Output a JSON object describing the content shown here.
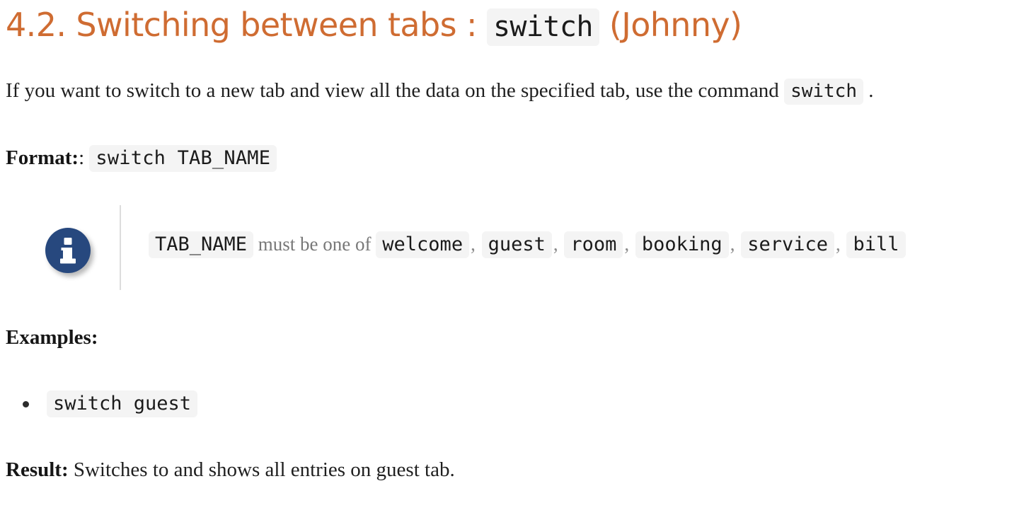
{
  "heading": {
    "number": "4.2.",
    "title": "Switching between tabs :",
    "command": "switch",
    "author": "(Johnny)",
    "color": "#cf6c32"
  },
  "intro": {
    "before": "If you want to switch to a new tab and view all the data on the specified tab, use the command",
    "code": "switch",
    "after": "."
  },
  "format": {
    "label": "Format:",
    "colon": ":",
    "code": "switch TAB_NAME"
  },
  "callout": {
    "icon": "info-icon",
    "icon_color": "#27487e",
    "param": "TAB_NAME",
    "text": "must be one of",
    "separator": ",",
    "options": [
      "welcome",
      "guest",
      "room",
      "booking",
      "service",
      "bill"
    ]
  },
  "examples": {
    "label": "Examples:",
    "items": [
      "switch guest"
    ]
  },
  "result": {
    "label": "Result:",
    "text": "Switches to and shows all entries on guest tab."
  }
}
